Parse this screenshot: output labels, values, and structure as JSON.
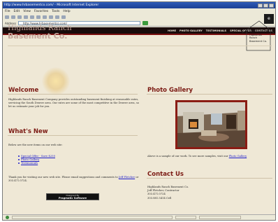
{
  "browser": {
    "title": "http://www.hrbasementco.com/ - Microsoft Internet Explorer",
    "menu": [
      "File",
      "Edit",
      "View",
      "Favorites",
      "Tools",
      "Help"
    ],
    "address_label": "Address",
    "address": "http://www.hrbasementco.com/",
    "logo_glyph": "e"
  },
  "nav": {
    "items": [
      "HOME",
      "PHOTO GALLERY",
      "TESTIMONIALS",
      "SPECIAL OFFER",
      "CONTACT US"
    ]
  },
  "logo": {
    "line1": "Highlands Ranch",
    "line2": "Basement Co."
  },
  "house_logo": {
    "line1": "Highlands",
    "line2": "Ranch",
    "line3": "Basement Co."
  },
  "welcome": {
    "heading": "Welcome",
    "text": "Highlands Ranch Basement Company provides outstanding basement finishing at reasonable rates, servicing the South Denver area. Our rates are some of the most competitive in the Denver area, so let us estimate your job for you."
  },
  "whats_new": {
    "heading": "What's New",
    "intro": "Below are the new items on our web site:",
    "links": [
      "Special Offer - Save $250",
      "Photo Gallery",
      "Testimonials"
    ],
    "thanks_prefix": "Thank you for visiting our new web site. Please email suggestions and comments to ",
    "thanks_link": "Jeff Fletcher",
    "thanks_suffix": " or 303.471.0724."
  },
  "badge": {
    "line1": "Designed By",
    "line2": "Pragmatic Software"
  },
  "gallery": {
    "heading": "Photo Gallery",
    "caption_prefix": "Above is a sample of our work. To see more samples, visit our ",
    "caption_link": "Photo Gallery"
  },
  "contact": {
    "heading": "Contact Us",
    "lines": [
      "Highlands Ranch Basement Co.",
      "Jeff Fletcher, Contractor",
      "303.471.0724",
      "303.881.5414 Cell"
    ]
  },
  "colors": {
    "heading": "#7b1a13",
    "link": "#1a1acc",
    "page_bg": "#efe8d6",
    "navbar_bg": "#190b0b"
  }
}
